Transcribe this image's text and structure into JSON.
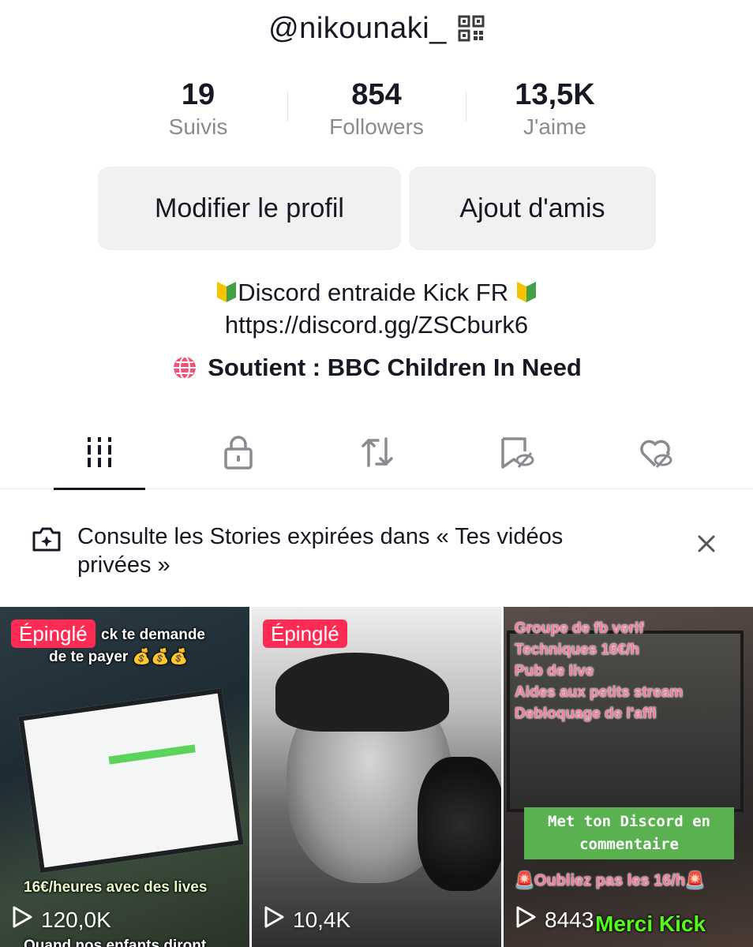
{
  "profile": {
    "username": "@nikounaki_",
    "stats": [
      {
        "value": "19",
        "label": "Suivis"
      },
      {
        "value": "854",
        "label": "Followers"
      },
      {
        "value": "13,5K",
        "label": "J'aime"
      }
    ],
    "buttons": {
      "edit": "Modifier le profil",
      "add_friends": "Ajout d'amis"
    },
    "bio": {
      "line1": "Discord entraide Kick FR",
      "line2": "https://discord.gg/ZSCburk6"
    },
    "support": "Soutient : BBC Children In Need"
  },
  "tabs": [
    {
      "name": "videos",
      "icon": "grid-icon",
      "active": true
    },
    {
      "name": "private",
      "icon": "lock-icon",
      "active": false
    },
    {
      "name": "reposts",
      "icon": "repost-icon",
      "active": false
    },
    {
      "name": "favorites",
      "icon": "bookmark-hidden-icon",
      "active": false
    },
    {
      "name": "liked",
      "icon": "heart-hidden-icon",
      "active": false
    }
  ],
  "notice": {
    "text": "Consulte les Stories expirées dans « Tes vidéos privées »"
  },
  "videos": [
    {
      "pinned": "Épinglé",
      "views": "120,0K",
      "caption_top": "ck te demande",
      "caption_top2": "de te payer 💰💰💰",
      "caption_bottom": "16€/heures avec des lives",
      "caption_bottom2": "Quand nos enfants diront"
    },
    {
      "pinned": "Épinglé",
      "views": "10,4K"
    },
    {
      "views": "8443",
      "list": [
        "Groupe de fb verif",
        "Techniques 16€/h",
        "Pub de live",
        "Aides aux petits stream",
        "Debloquage de l'affi"
      ],
      "discord_box": "Met ton Discord en commentaire",
      "caption_bottom": "🚨Oubliez pas les 16/h🚨",
      "caption_kick": "Merci Kick"
    }
  ],
  "colors": {
    "accent": "#fe2c55",
    "button_bg": "#f1f1f2",
    "muted_text": "#8a8b91"
  }
}
